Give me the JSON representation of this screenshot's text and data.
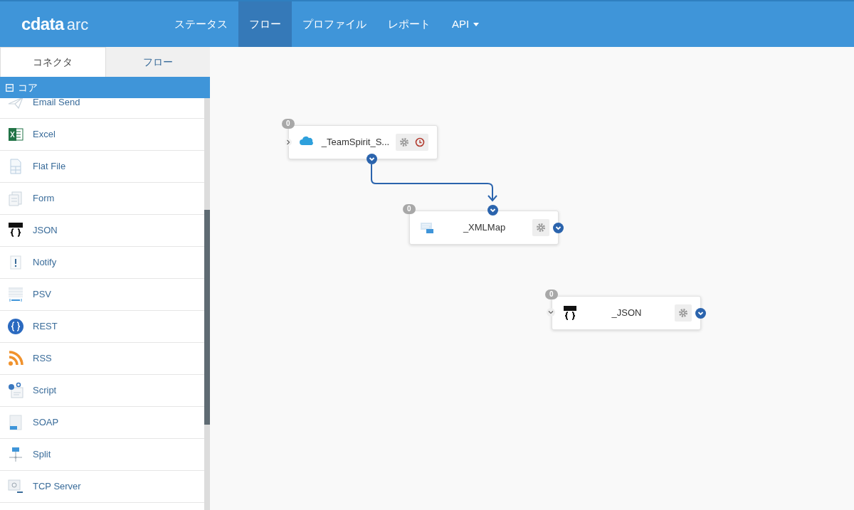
{
  "brand": {
    "logo": "cdata",
    "product": "arc"
  },
  "nav": [
    {
      "label": "ステータス",
      "selected": false
    },
    {
      "label": "フロー",
      "selected": true
    },
    {
      "label": "プロファイル",
      "selected": false
    },
    {
      "label": "レポート",
      "selected": false
    },
    {
      "label": "API",
      "selected": false,
      "dropdown": true
    }
  ],
  "sidebar": {
    "tabs": [
      {
        "label": "コネクタ",
        "selected": true
      },
      {
        "label": "フロー",
        "selected": false
      }
    ],
    "group": {
      "label": "コア",
      "expanded": true
    },
    "items": [
      {
        "label": "Email Send",
        "kind": "email"
      },
      {
        "label": "Excel",
        "kind": "excel"
      },
      {
        "label": "Flat File",
        "kind": "flatfile"
      },
      {
        "label": "Form",
        "kind": "form"
      },
      {
        "label": "JSON",
        "kind": "json"
      },
      {
        "label": "Notify",
        "kind": "notify"
      },
      {
        "label": "PSV",
        "kind": "psv"
      },
      {
        "label": "REST",
        "kind": "rest"
      },
      {
        "label": "RSS",
        "kind": "rss"
      },
      {
        "label": "Script",
        "kind": "script"
      },
      {
        "label": "SOAP",
        "kind": "soap"
      },
      {
        "label": "Split",
        "kind": "split"
      },
      {
        "label": "TCP Server",
        "kind": "tcp"
      }
    ]
  },
  "canvas": {
    "nodes": [
      {
        "label": "_TeamSpirit_S...",
        "badge": "0",
        "kind": "cloud",
        "toggle_expanded": false,
        "scheduled": true,
        "input_port": false
      },
      {
        "label": "_XMLMap",
        "badge": "0",
        "kind": "xmlmap",
        "scheduled": false,
        "input_port": true
      },
      {
        "label": "_JSON",
        "badge": "0",
        "kind": "json",
        "toggle_expanded": true,
        "scheduled": false,
        "input_port": false
      }
    ]
  }
}
